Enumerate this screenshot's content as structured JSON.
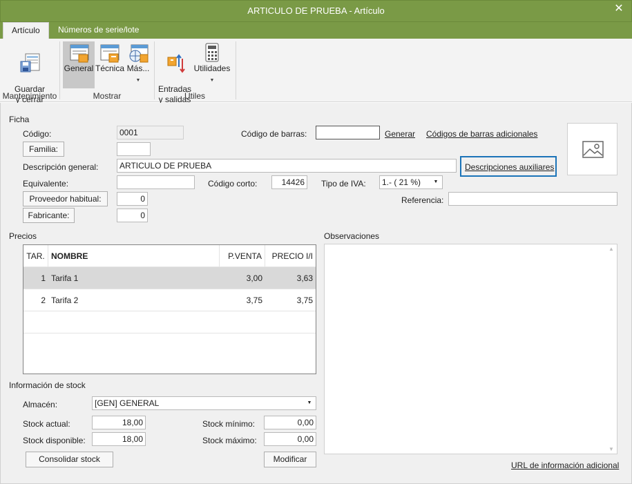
{
  "window": {
    "title": "ARTICULO DE PRUEBA - Artículo",
    "close_glyph": "✕"
  },
  "tabs": [
    {
      "label": "Artículo"
    },
    {
      "label": "Números de serie/lote"
    }
  ],
  "ribbon": {
    "groups": [
      {
        "label": "Mantenimiento",
        "buttons": [
          {
            "label": "Guardar\ny cerrar",
            "icon": "save-close-icon"
          }
        ]
      },
      {
        "label": "Mostrar",
        "buttons": [
          {
            "label": "General",
            "icon": "general-view-icon"
          },
          {
            "label": "Técnica",
            "icon": "technical-view-icon"
          },
          {
            "label": "Más...",
            "icon": "more-views-icon"
          }
        ]
      },
      {
        "label": "Útiles",
        "buttons": [
          {
            "label": "Entradas\ny salidas",
            "icon": "inputs-outputs-icon"
          },
          {
            "label": "Utilidades",
            "icon": "calculator-icon"
          }
        ]
      }
    ]
  },
  "ficha": {
    "section_label": "Ficha",
    "codigo_label": "Código:",
    "codigo_value": "0001",
    "familia_button": "Familia:",
    "familia_value": "",
    "descripcion_label": "Descripción general:",
    "descripcion_value": "ARTICULO DE PRUEBA",
    "equivalente_label": "Equivalente:",
    "equivalente_value": "",
    "proveedor_button": "Proveedor habitual:",
    "proveedor_value": "0",
    "fabricante_button": "Fabricante:",
    "fabricante_value": "0",
    "codigo_barras_label": "Código de barras:",
    "codigo_barras_value": "",
    "generar_link": "Generar",
    "codigos_adicionales_link": "Códigos de barras adicionales",
    "descripciones_aux_link": "Descripciones auxiliares",
    "codigo_corto_label": "Código corto:",
    "codigo_corto_value": "14426",
    "tipo_iva_label": "Tipo de IVA:",
    "tipo_iva_value": "1.- ( 21 %)",
    "referencia_label": "Referencia:",
    "referencia_value": ""
  },
  "precios": {
    "section_label": "Precios",
    "columns": [
      "TAR.",
      "NOMBRE",
      "P.VENTA",
      "PRECIO I/I"
    ],
    "rows": [
      {
        "tar": "1",
        "nombre": "Tarifa 1",
        "pventa": "3,00",
        "precio_ii": "3,63"
      },
      {
        "tar": "2",
        "nombre": "Tarifa 2",
        "pventa": "3,75",
        "precio_ii": "3,75"
      }
    ]
  },
  "observaciones": {
    "section_label": "Observaciones",
    "value": ""
  },
  "stock": {
    "section_label": "Información de stock",
    "almacen_label": "Almacén:",
    "almacen_value": "[GEN] GENERAL",
    "stock_actual_label": "Stock actual:",
    "stock_actual_value": "18,00",
    "stock_disponible_label": "Stock disponible:",
    "stock_disponible_value": "18,00",
    "stock_minimo_label": "Stock mínimo:",
    "stock_minimo_value": "0,00",
    "stock_maximo_label": "Stock máximo:",
    "stock_maximo_value": "0,00",
    "consolidar_button": "Consolidar stock",
    "modificar_button": "Modificar"
  },
  "url_info_link": "URL de información adicional",
  "colors": {
    "titlebar": "#7a9a46",
    "ribbon": "#f3f3f3",
    "panel": "#f0f0f0",
    "focus_border": "#1a73b8"
  }
}
